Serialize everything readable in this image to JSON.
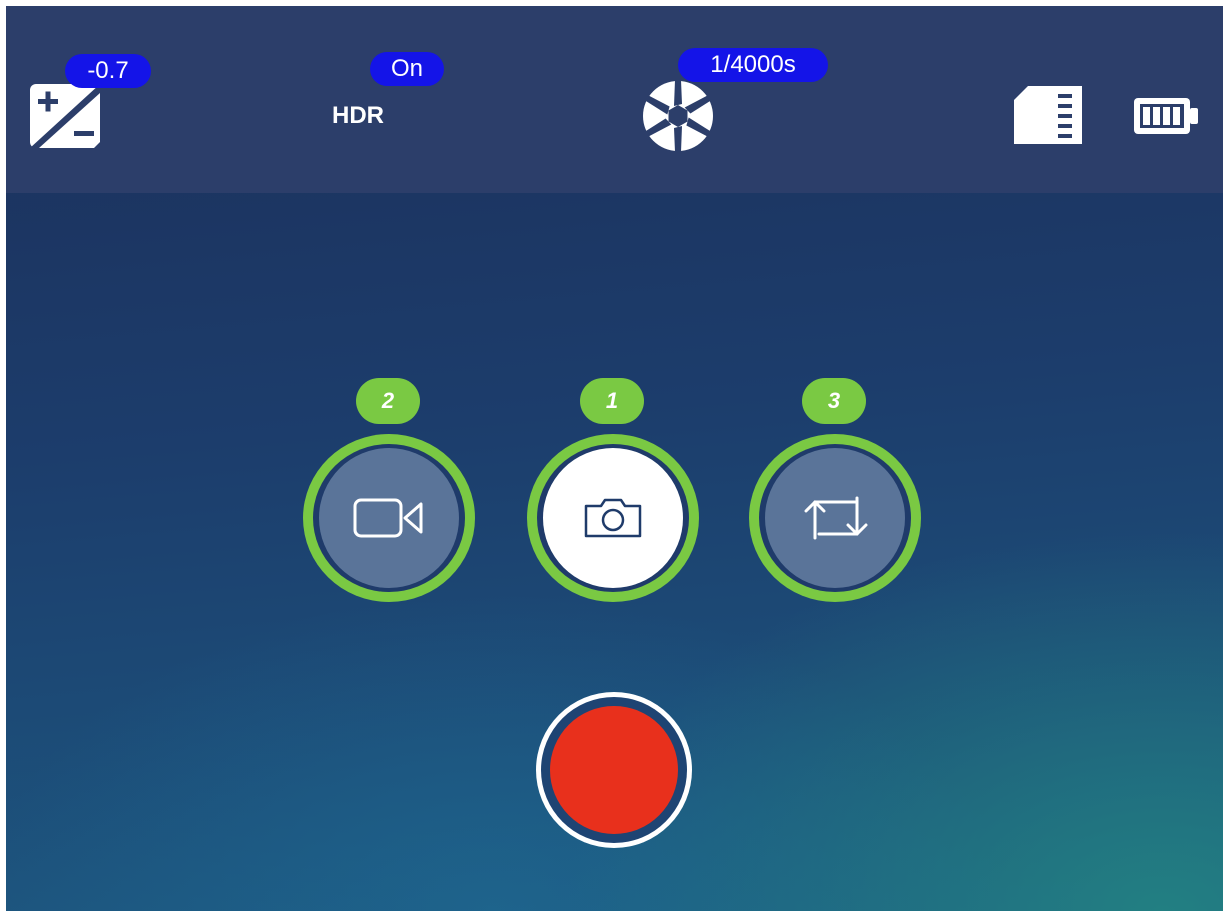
{
  "topbar": {
    "exposure": {
      "value": "-0.7",
      "icon": "exposure-compensation-icon"
    },
    "hdr": {
      "status": "On",
      "label": "HDR"
    },
    "shutter": {
      "value": "1/4000s",
      "icon": "aperture-icon"
    },
    "storage_icon": "sd-card-icon",
    "battery_icon": "battery-icon"
  },
  "modes": [
    {
      "name": "video",
      "number": "2",
      "icon": "video-camera-icon",
      "selected": false
    },
    {
      "name": "photo",
      "number": "1",
      "icon": "camera-icon",
      "selected": true
    },
    {
      "name": "switch",
      "number": "3",
      "icon": "switch-arrows-icon",
      "selected": false
    }
  ],
  "shutter_button": {
    "icon": "record-button"
  },
  "colors": {
    "badge": "#1414e8",
    "topbar": "#2c3e6a",
    "mode_ring": "#7ac943",
    "record": "#e8301c"
  }
}
